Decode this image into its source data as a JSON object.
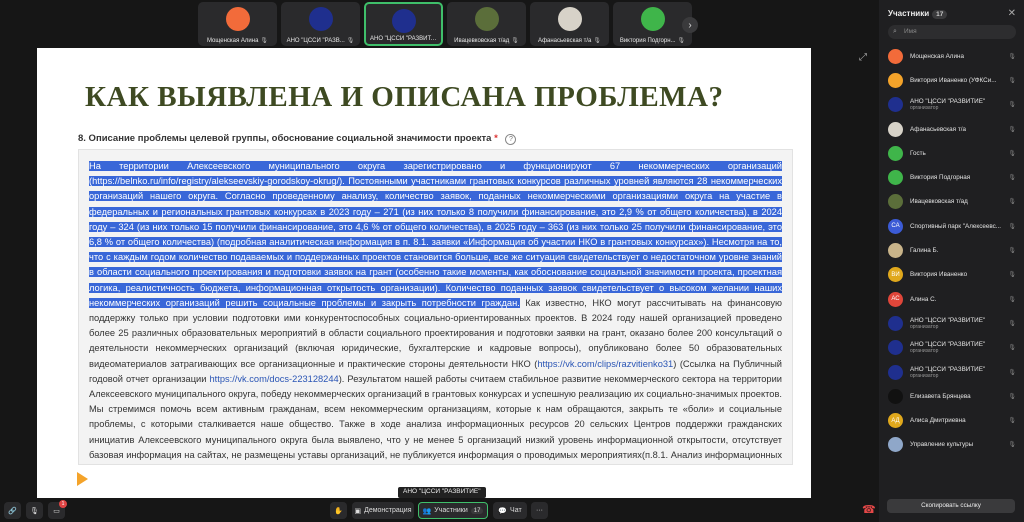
{
  "top_tiles": [
    {
      "name": "Мощенская Алина",
      "initials": "",
      "color": "#f26b3a",
      "icon": "user-icon"
    },
    {
      "name": "АНО \"ЦССИ \"РАЗВ...",
      "initials": "",
      "color": "#1f2f8e",
      "icon": "logo-icon"
    },
    {
      "name": "АНО \"ЦССИ \"РАЗВИТ...",
      "initials": "",
      "color": "#1f2f8e",
      "icon": "logo-icon",
      "active": true
    },
    {
      "name": "Ивацевковская т/ад",
      "initials": "",
      "color": "#5b6e3a",
      "icon": "photo-icon"
    },
    {
      "name": "Афанасьевская т/а",
      "initials": "",
      "color": "#d7d2c8",
      "icon": "crest-icon"
    },
    {
      "name": "Виктория Подгорн...",
      "initials": "",
      "color": "#3fb54a",
      "icon": "user-icon"
    }
  ],
  "slide": {
    "title": "КАК ВЫЯВЛЕНА И ОПИСАНА ПРОБЛЕМА?",
    "question": "8. Описание проблемы целевой группы, обоснование социальной значимости проекта",
    "question_star": "*",
    "help_label": "?",
    "selected_text": "На территории Алексеевского муниципального округа зарегистрировано и функционируют 67 некоммерческих организаций (https://belnko.ru/info/registry/alekseevskiy-gorodskoy-okrug/). Постоянными участниками грантовых конкурсов различных уровней являются 28 некоммерческих организаций нашего округа. Согласно проведенному анализу, количество заявок, поданных некоммерческими организациями округа на участие в федеральных и региональных грантовых конкурсах в 2023 году – 271 (из них только 8 получили финансирование, это 2,9 % от общего количества), в 2024 году – 324 (из них только 15 получили финансирование, это 4,6 % от общего количества), в 2025 году – 363 (из них только 25 получили финансирование, это 6,8 % от общего количества) (подробная аналитическая информация в п. 8.1. заявки «Информация об участии НКО в грантовых конкурсах»). Несмотря на то, что с каждым годом количество подаваемых и поддержанных проектов становится больше, все же ситуация свидетельствует о недостаточном уровне знаний в области социального проектирования и подготовки заявок на грант (особенно такие моменты, как обоснование социальной значимости проекта, проектная логика, реалистичность бюджета, информационная открытость организации). Количество поданных заявок свидетельствует о высоком желании наших некоммерческих организаций решить социальные проблемы и закрыть потребности граждан.",
    "text_part1": " Как известно, НКО могут рассчитывать на финансовую поддержку только при условии подготовки ими конкурентоспособных социально-ориентированных проектов. В 2024 году нашей организацией проведено более 25 различных образовательных мероприятий в области социального проектирования и подготовки заявки на грант, оказано более 200 консультаций о деятельности некоммерческих организаций (включая юридические, бухгалтерские и кадровые вопросы), опубликовано более 50 образовательных видеоматериалов затрагивающих все организационные и практические стороны деятельности НКО (",
    "link1": "https://vk.com/clips/razvitienko31",
    "text_part2": ") (Ссылка на Публичный годовой отчет организации ",
    "link2": "https://vk.com/docs-223128244",
    "text_part3": "). Результатом нашей работы считаем стабильное развитие некоммерческого сектора на территории Алексеевского муниципального округа, победу некоммерческих организаций в грантовых конкурсах и успешную реализацию их социально-значимых проектов. Мы стремимся помочь всем активным гражданам, всем некоммерческим организациям, которые к нам обращаются, закрыть те «боли» и социальные проблемы, с которыми сталкивается наше общество. Также в ходе анализа информационных ресурсов 20 сельских Центров поддержки гражданских инициатив Алексеевского муниципального округа была выявлено, что у не менее 5 организаций низкий уровень информационной открытости, отсутствует базовая информация на сайтах, не размещены уставы организаций, не публикуется информация о проводимых мероприятиях(п.8.1. Анализ информационных ресурсов НКО). Проект «НКО-навигатор» направлен на развитие некоммерческого сектора в проектной деятельности через организацию"
  },
  "speaker_label": "АНО \"ЦССИ \"РАЗВИТИЕ\"",
  "panel": {
    "title": "Участники",
    "count": "17",
    "search_placeholder": "Имя",
    "copy_link": "Скопировать ссылку",
    "participants": [
      {
        "name": "Мощенская Алина",
        "sub": "",
        "initials": "",
        "color": "#f26b3a"
      },
      {
        "name": "Виктория Иваненко (УФКСи...",
        "sub": "",
        "initials": "",
        "color": "#f4a32a"
      },
      {
        "name": "АНО \"ЦССИ \"РАЗВИТИЕ\"",
        "sub": "организатор",
        "initials": "",
        "color": "#1f2f8e"
      },
      {
        "name": "Афанасьевская т/а",
        "sub": "",
        "initials": "",
        "color": "#d7d2c8"
      },
      {
        "name": "Гость",
        "sub": "",
        "initials": "",
        "color": "#3fb54a"
      },
      {
        "name": "Виктория Подгорная",
        "sub": "",
        "initials": "",
        "color": "#3fb54a"
      },
      {
        "name": "Ивацевковская т/ад",
        "sub": "",
        "initials": "",
        "color": "#5b6e3a"
      },
      {
        "name": "Спортивный парк \"Алексеевс...",
        "sub": "",
        "initials": "СА",
        "color": "#3b5bd6"
      },
      {
        "name": "Галина Б.",
        "sub": "",
        "initials": "",
        "color": "#c9b48a"
      },
      {
        "name": "Виктория Иваненко",
        "sub": "",
        "initials": "ВИ",
        "color": "#e0a81c"
      },
      {
        "name": "Алина С.",
        "sub": "",
        "initials": "АС",
        "color": "#e0463a"
      },
      {
        "name": "АНО \"ЦССИ \"РАЗВИТИЕ\"",
        "sub": "организатор",
        "initials": "",
        "color": "#1f2f8e"
      },
      {
        "name": "АНО \"ЦССИ \"РАЗВИТИЕ\"",
        "sub": "организатор",
        "initials": "",
        "color": "#1f2f8e"
      },
      {
        "name": "АНО \"ЦССИ \"РАЗВИТИЕ\"",
        "sub": "организатор",
        "initials": "",
        "color": "#1f2f8e"
      },
      {
        "name": "Елизавета Брянцева",
        "sub": "",
        "initials": "",
        "color": "#111111"
      },
      {
        "name": "Алиса Дмитриевна",
        "sub": "",
        "initials": "АД",
        "color": "#e0a81c"
      },
      {
        "name": "Управление культуры",
        "sub": "",
        "initials": "",
        "color": "#8fa7c9"
      }
    ]
  },
  "bottom": {
    "badge_count": "1",
    "demo_label": "Демонстрация",
    "participants_label": "Участники",
    "participants_count": "17",
    "chat_label": "Чат",
    "more_label": "···"
  }
}
